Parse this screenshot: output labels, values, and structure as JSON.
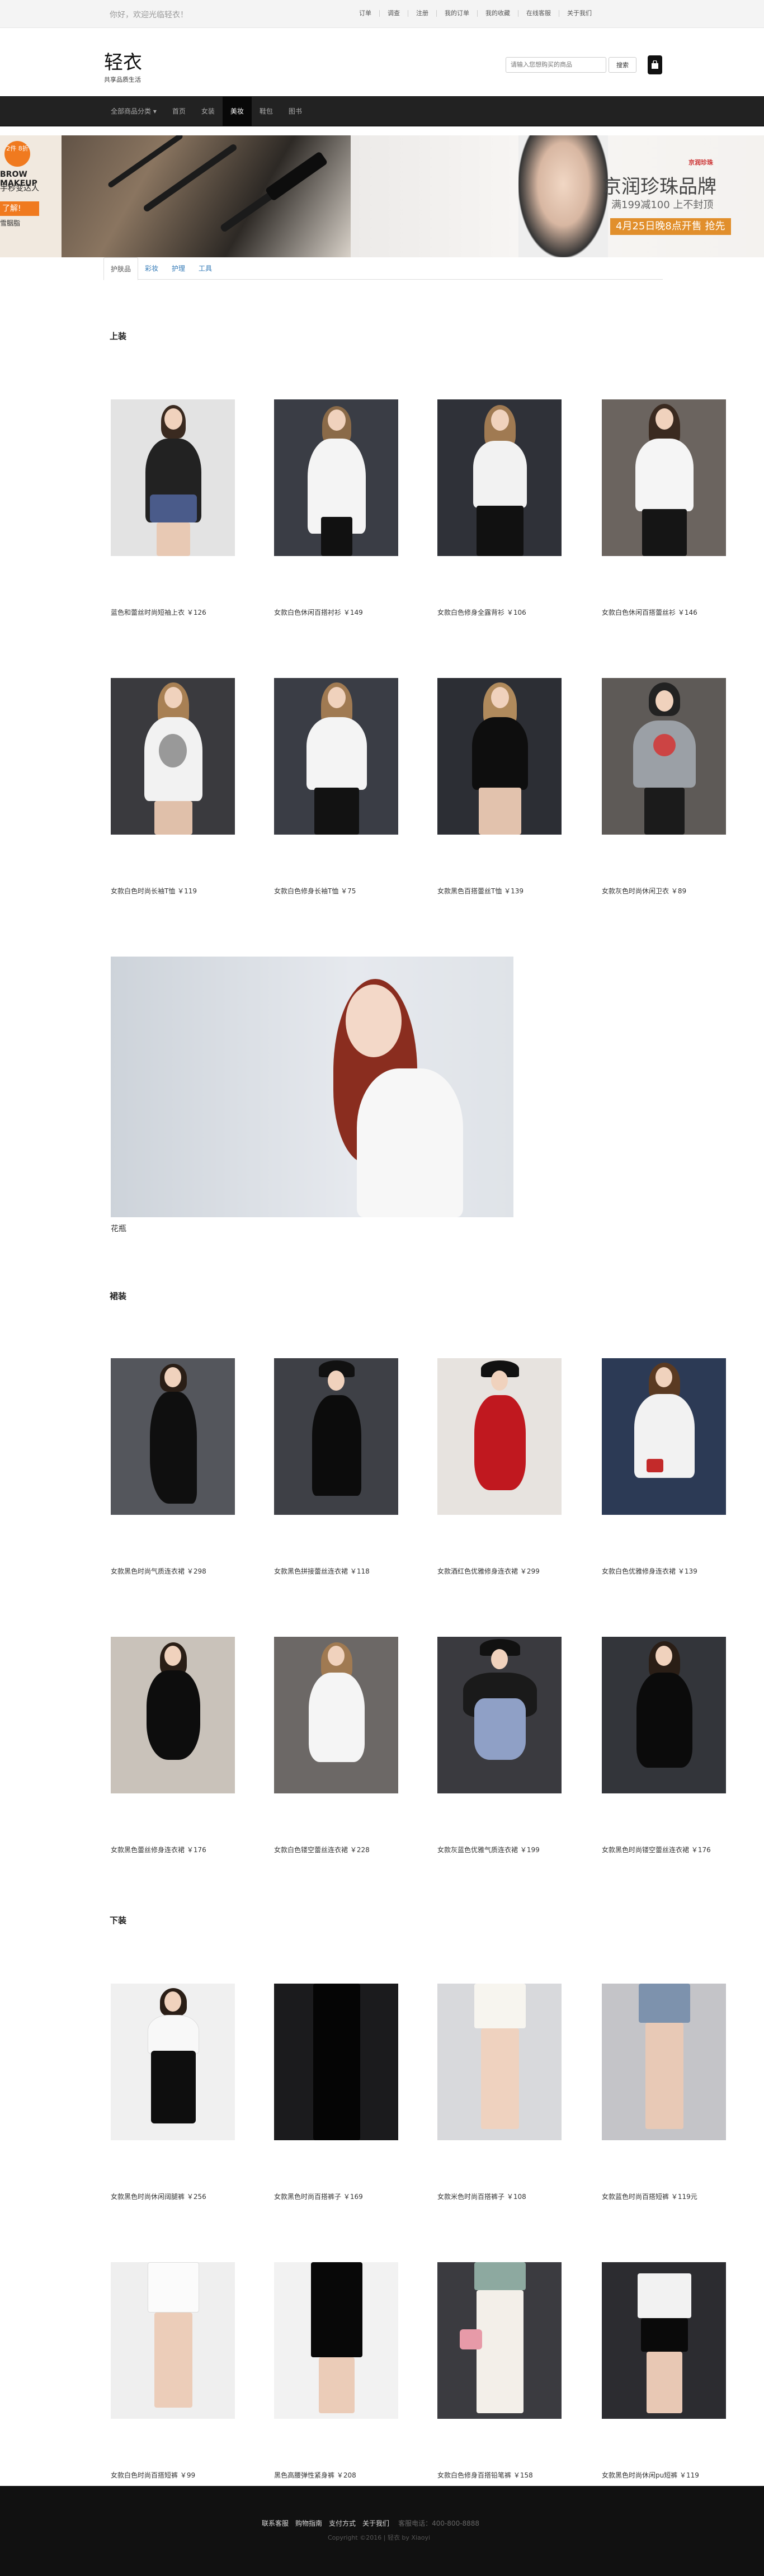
{
  "topbar": {
    "welcome": "你好，欢迎光临轻衣！",
    "links": [
      "订单",
      "调查",
      "注册",
      "我的订单",
      "我的收藏",
      "在线客服",
      "关于我们"
    ]
  },
  "header": {
    "logo": "轻衣",
    "slogan": "共享品质生活",
    "search_placeholder": "请输入您想购买的商品",
    "search_button": "搜索",
    "cart_icon": "shopping-bag-icon"
  },
  "nav": {
    "items": [
      "全部商品分类 ▾",
      "首页",
      "女装",
      "美妆",
      "鞋包",
      "图书"
    ],
    "active_index": 3
  },
  "banner": {
    "left": {
      "badge": "2件 8折",
      "line1": "BROW MAKEUP",
      "line2": "手秒变达人",
      "button": "了解!",
      "sub": "雪胭脂"
    },
    "right": {
      "brand": "京润珍珠",
      "title": "京润珍珠品牌",
      "subtitle": "满199减100 上不封顶",
      "date": "4月25日晚8点开售 抢先"
    }
  },
  "subtabs": {
    "items": [
      "护肤品",
      "彩妆",
      "护理",
      "工具"
    ],
    "active_index": 0
  },
  "sections": [
    {
      "title": "上装",
      "products": [
        {
          "caption": "蓝色和蕾丝时尚短袖上衣 ￥126"
        },
        {
          "caption": "女款白色休闲百搭衬衫 ￥149"
        },
        {
          "caption": "女款白色修身全露背衫 ￥106"
        },
        {
          "caption": "女款白色休闲百搭蕾丝衫 ￥146"
        },
        {
          "caption": "女款白色时尚长袖T恤 ￥119"
        },
        {
          "caption": "女款白色修身长袖T恤 ￥75"
        },
        {
          "caption": "女款黑色百搭蕾丝T恤 ￥139"
        },
        {
          "caption": "女款灰色时尚休闲卫衣 ￥89"
        }
      ]
    },
    {
      "title": "裙装",
      "products": [
        {
          "caption": "女款黑色时尚气质连衣裙 ￥298"
        },
        {
          "caption": "女款黑色拼接蕾丝连衣裙 ￥118"
        },
        {
          "caption": "女款酒红色优雅修身连衣裙 ￥299"
        },
        {
          "caption": "女款白色优雅修身连衣裙 ￥139"
        },
        {
          "caption": "女款黑色蕾丝修身连衣裙 ￥176"
        },
        {
          "caption": "女款白色镂空蕾丝连衣裙 ￥228"
        },
        {
          "caption": "女款灰蓝色优雅气质连衣裙 ￥199"
        },
        {
          "caption": "女款黑色时尚镂空蕾丝连衣裙 ￥176"
        }
      ]
    },
    {
      "title": "下装",
      "products": [
        {
          "caption": "女款黑色时尚休闲阔腿裤 ￥256"
        },
        {
          "caption": "女款黑色时尚百搭裤子 ￥169"
        },
        {
          "caption": "女款米色时尚百搭裤子 ￥108"
        },
        {
          "caption": "女款蓝色时尚百搭短裤 ￥119元"
        },
        {
          "caption": "女款白色时尚百搭短裤 ￥99"
        },
        {
          "caption": "黑色高腰弹性紧身裤 ￥208"
        },
        {
          "caption": "女款白色修身百搭铅笔裤 ￥158"
        },
        {
          "caption": "女款黑色时尚休闲pu短裤 ￥119"
        }
      ]
    }
  ],
  "feature": {
    "caption": "花瓶"
  },
  "footer": {
    "links": [
      "联系客服",
      "购物指南",
      "支付方式",
      "关于我们"
    ],
    "contact": "客服电话：400-800-8888",
    "copyright": "Copyright ©2016 | 轻衣 by Xiaoyi"
  }
}
